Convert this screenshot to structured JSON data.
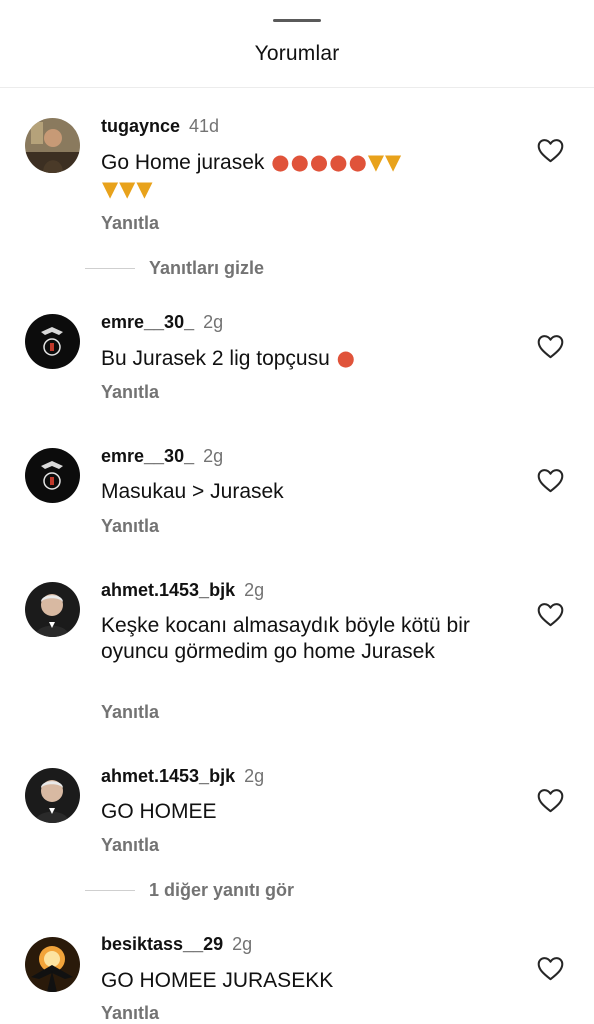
{
  "sheet": {
    "title": "Yorumlar"
  },
  "comments": [
    {
      "username": "tugaynce",
      "time": "41d",
      "text": "Go Home jurasek",
      "emojis": [
        "angry-face",
        "cursing-face",
        "angry-face",
        "cursing-face",
        "cursing-face",
        "thumbs-down",
        "thumbs-down",
        "thumbs-down",
        "thumbs-down",
        "thumbs-down"
      ],
      "reply_label": "Yanıtla"
    },
    {
      "username": "emre__30_",
      "time": "2g",
      "text": "Bu Jurasek 2 lig topçusu",
      "emojis": [
        "angry-face"
      ],
      "reply_label": "Yanıtla"
    },
    {
      "username": "emre__30_",
      "time": "2g",
      "text": "Masukau > Jurasek",
      "reply_label": "Yanıtla"
    },
    {
      "username": "ahmet.1453_bjk",
      "time": "2g",
      "text": "Keşke kocanı almasaydık böyle kötü bir oyuncu görmedim go home Jurasek",
      "reply_label": "Yanıtla"
    },
    {
      "username": "ahmet.1453_bjk",
      "time": "2g",
      "text": "GO HOMEE",
      "reply_label": "Yanıtla"
    },
    {
      "username": "besiktass__29",
      "time": "2g",
      "text": "GO HOMEE JURASEKK",
      "reply_label": "Yanıtla"
    }
  ],
  "thread_toggles": {
    "hide_replies": "Yanıtları gizle",
    "view_more": "1 diğer yanıtı gör"
  },
  "colors": {
    "muted": "#737373",
    "text": "#111111",
    "angry": "#e0533a",
    "thumb": "#e8a21b"
  }
}
